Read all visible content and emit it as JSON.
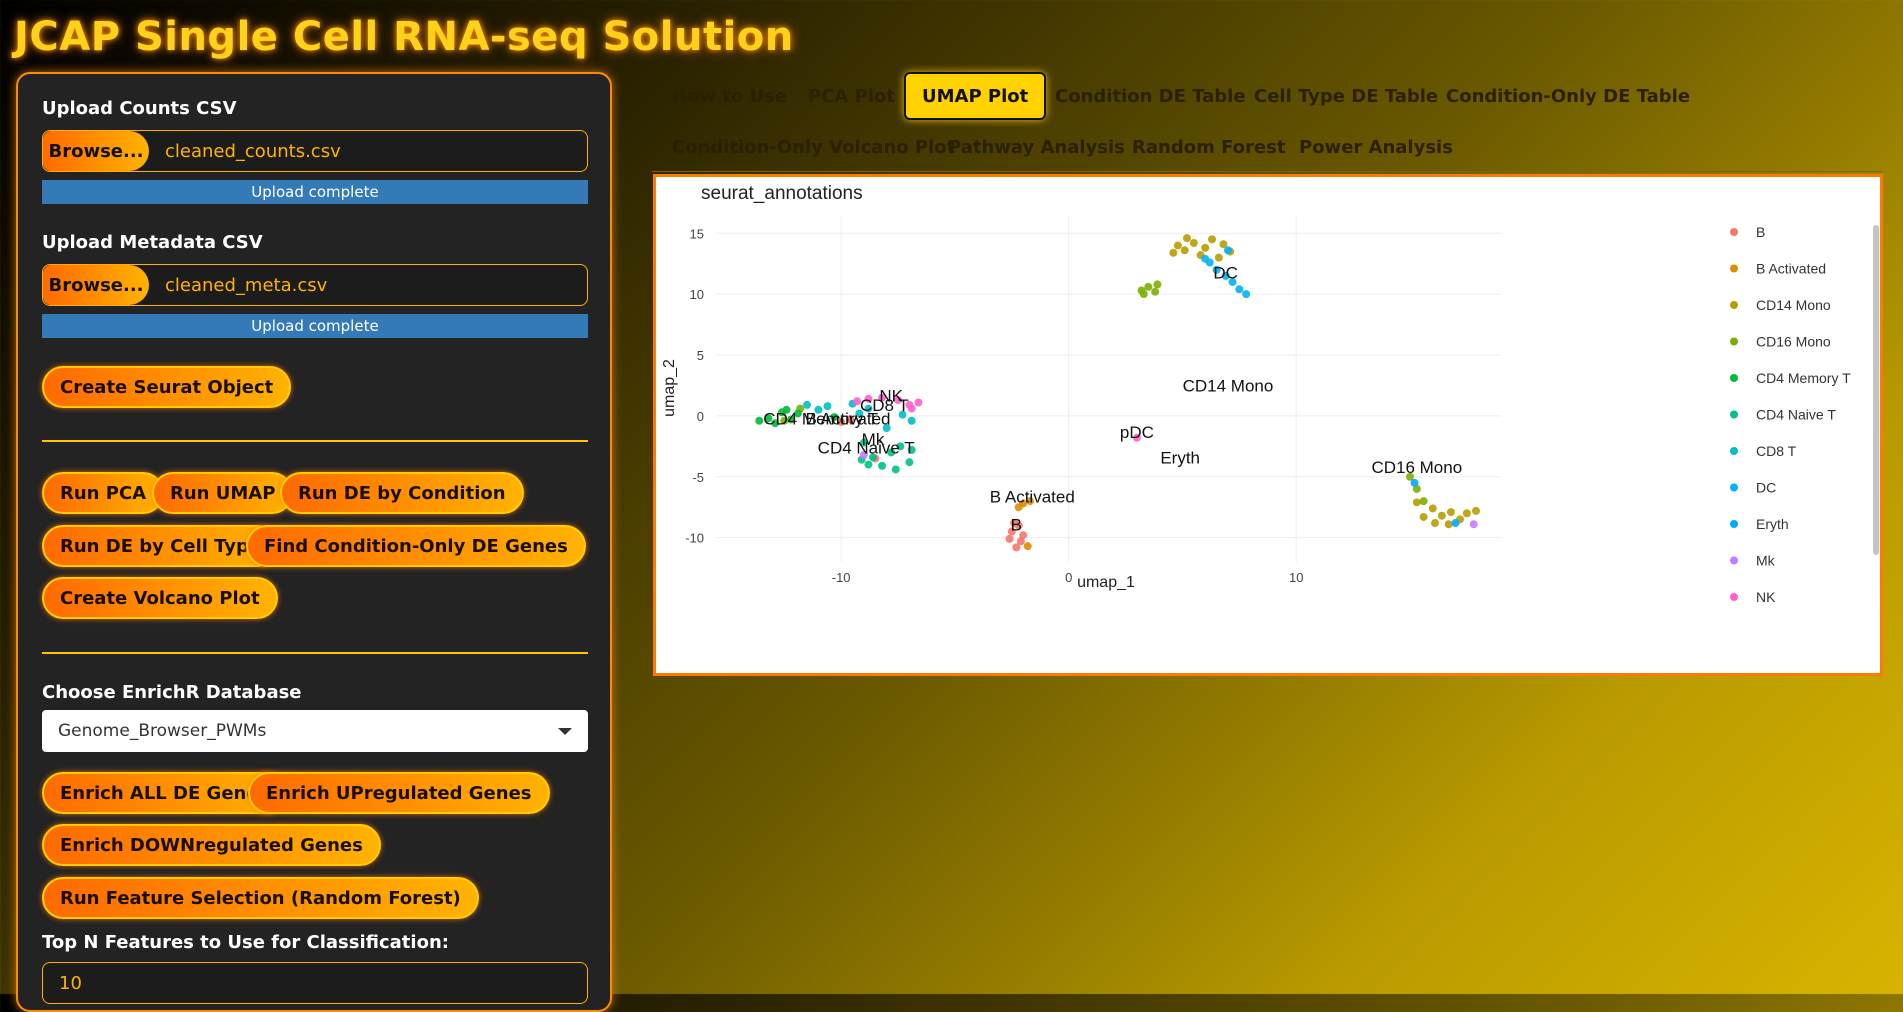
{
  "app": {
    "title": "JCAP Single Cell RNA-seq Solution"
  },
  "sidebar": {
    "counts": {
      "label": "Upload Counts CSV",
      "browse": "Browse...",
      "filename": "cleaned_counts.csv",
      "status": "Upload complete"
    },
    "meta": {
      "label": "Upload Metadata CSV",
      "browse": "Browse...",
      "filename": "cleaned_meta.csv",
      "status": "Upload complete"
    },
    "create_seurat": "Create Seurat Object",
    "run_pca": "Run PCA",
    "run_umap": "Run UMAP",
    "run_de_condition": "Run DE by Condition",
    "run_de_celltype": "Run DE by Cell Type",
    "find_condition_only": "Find Condition-Only DE Genes",
    "create_volcano": "Create Volcano Plot",
    "enrichr_label": "Choose EnrichR Database",
    "enrichr_selected": "Genome_Browser_PWMs",
    "enrich_all": "Enrich ALL DE Genes",
    "enrich_up": "Enrich UPregulated Genes",
    "enrich_down": "Enrich DOWNregulated Genes",
    "run_rf": "Run Feature Selection (Random Forest)",
    "topn_label": "Top N Features to Use for Classification:",
    "topn_value": "10"
  },
  "tabs": [
    {
      "label": "How to Use"
    },
    {
      "label": "PCA Plot"
    },
    {
      "label": "UMAP Plot",
      "active": true
    },
    {
      "label": "Condition DE Table"
    },
    {
      "label": "Cell Type DE Table"
    },
    {
      "label": "Condition-Only DE Table"
    },
    {
      "label": "Condition-Only Volcano Plot"
    },
    {
      "label": "Pathway Analysis"
    },
    {
      "label": "Random Forest"
    },
    {
      "label": "Power Analysis"
    }
  ],
  "chart_data": {
    "type": "scatter",
    "title": "seurat_annotations",
    "xlabel": "umap_1",
    "ylabel": "umap_2",
    "xlim": [
      -15.5,
      19
    ],
    "ylim": [
      -12,
      16.5
    ],
    "xticks": [
      -10,
      0,
      10
    ],
    "yticks": [
      15,
      10,
      5,
      0,
      -5,
      -10
    ],
    "grid": true,
    "legend_position": "right",
    "series": [
      {
        "name": "B",
        "color": "#F8766D",
        "points": [
          [
            -2.2,
            -9
          ],
          [
            -2.5,
            -9.5
          ],
          [
            -2.1,
            -10.3
          ],
          [
            -2.3,
            -10.8
          ],
          [
            -2.6,
            -10.1
          ],
          [
            -2.0,
            -9.8
          ],
          [
            -2.4,
            -8.8
          ],
          [
            -8.5,
            -3.5
          ],
          [
            -10,
            -0.5
          ],
          [
            -9.6,
            -0.3
          ]
        ]
      },
      {
        "name": "B Activated",
        "color": "#DE8C00",
        "points": [
          [
            -2.2,
            -7.5
          ],
          [
            -1.7,
            -7.0
          ],
          [
            -1.8,
            -10.7
          ],
          [
            -2.0,
            -7.2
          ]
        ]
      },
      {
        "name": "CD14 Mono",
        "color": "#B79F00",
        "points": [
          [
            4.8,
            14.0
          ],
          [
            5.1,
            13.6
          ],
          [
            5.5,
            14.2
          ],
          [
            6.0,
            13.8
          ],
          [
            6.3,
            14.5
          ],
          [
            6.8,
            14.1
          ],
          [
            7.1,
            13.5
          ],
          [
            5.8,
            13.2
          ],
          [
            5.2,
            14.6
          ],
          [
            6.6,
            13.0
          ],
          [
            4.6,
            13.4
          ],
          [
            16.0,
            -7.6
          ],
          [
            16.4,
            -8.2
          ],
          [
            16.8,
            -7.9
          ],
          [
            17.2,
            -8.5
          ],
          [
            16.1,
            -8.8
          ],
          [
            17.5,
            -8.0
          ],
          [
            15.6,
            -8.3
          ],
          [
            16.7,
            -8.9
          ],
          [
            17.9,
            -7.8
          ],
          [
            15.3,
            -7.1
          ]
        ]
      },
      {
        "name": "CD16 Mono",
        "color": "#7CAE00",
        "points": [
          [
            3.2,
            10.3
          ],
          [
            3.5,
            10.6
          ],
          [
            3.8,
            10.2
          ],
          [
            3.3,
            10.0
          ],
          [
            3.9,
            10.8
          ],
          [
            -12.5,
            -0.4
          ],
          [
            -11.8,
            0.6
          ],
          [
            15.0,
            -5.0
          ],
          [
            15.3,
            -6.0
          ],
          [
            15.6,
            -7.0
          ]
        ]
      },
      {
        "name": "CD4 Memory T",
        "color": "#00BA38",
        "points": [
          [
            -13.2,
            -0.2
          ],
          [
            -12.9,
            -0.6
          ],
          [
            -12.6,
            0.3
          ],
          [
            -12.2,
            -0.3
          ],
          [
            -11.9,
            0.2
          ],
          [
            -13.6,
            -0.4
          ],
          [
            -12.4,
            0.5
          ],
          [
            -10.3,
            -0.1
          ]
        ]
      },
      {
        "name": "CD4 Naive T",
        "color": "#00C08B",
        "points": [
          [
            -9.0,
            -2.2
          ],
          [
            -8.6,
            -3.4
          ],
          [
            -8.2,
            -4.1
          ],
          [
            -7.8,
            -3.0
          ],
          [
            -7.4,
            -2.5
          ],
          [
            -7.0,
            -3.8
          ],
          [
            -8.8,
            -4.0
          ],
          [
            -7.6,
            -4.4
          ],
          [
            -9.1,
            -3.6
          ],
          [
            -6.9,
            -2.8
          ]
        ]
      },
      {
        "name": "CD8 T",
        "color": "#00BFC4",
        "points": [
          [
            -11.5,
            0.9
          ],
          [
            -11.0,
            0.5
          ],
          [
            -10.6,
            0.8
          ],
          [
            -9.2,
            0.2
          ],
          [
            -8.8,
            0.6
          ],
          [
            -7.3,
            0.1
          ],
          [
            -6.9,
            -0.4
          ],
          [
            -8.0,
            -1.0
          ],
          [
            -9.5,
            1.0
          ]
        ]
      },
      {
        "name": "DC",
        "color": "#00B4F0",
        "points": [
          [
            6.2,
            12.6
          ],
          [
            6.5,
            12.0
          ],
          [
            6.9,
            11.5
          ],
          [
            7.2,
            11.0
          ],
          [
            7.5,
            10.4
          ],
          [
            7.8,
            10.0
          ],
          [
            6.0,
            12.9
          ],
          [
            7.0,
            13.6
          ]
        ]
      },
      {
        "name": "Eryth",
        "color": "#00A9FF",
        "points": [
          [
            17.0,
            -8.8
          ],
          [
            15.2,
            -5.5
          ]
        ]
      },
      {
        "name": "Mk",
        "color": "#C77CFF",
        "points": [
          [
            -9.0,
            -3.2
          ],
          [
            17.8,
            -8.9
          ]
        ]
      },
      {
        "name": "NK",
        "color": "#FF61CC",
        "points": [
          [
            -7.5,
            1.3
          ],
          [
            -7.0,
            0.9
          ],
          [
            -6.6,
            1.1
          ],
          [
            -8.2,
            1.5
          ],
          [
            -8.8,
            1.4
          ],
          [
            -6.9,
            0.6
          ],
          [
            -9.3,
            1.2
          ]
        ]
      },
      {
        "name": "pDC",
        "color": "#FF61CC",
        "points": [
          [
            3.0,
            -1.8
          ]
        ]
      }
    ],
    "annotations": [
      {
        "text": "DC",
        "x": 6.9,
        "y": 11.3
      },
      {
        "text": "CD14 Mono",
        "x": 7.0,
        "y": 2.0
      },
      {
        "text": "pDC",
        "x": 3.0,
        "y": -1.8
      },
      {
        "text": "Eryth",
        "x": 4.9,
        "y": -3.9
      },
      {
        "text": "CD16 Mono",
        "x": 15.3,
        "y": -4.7
      },
      {
        "text": "B Activated",
        "x": -1.6,
        "y": -7.1
      },
      {
        "text": "B",
        "x": -2.3,
        "y": -9.4
      },
      {
        "text": "NK",
        "x": -7.8,
        "y": 1.2
      },
      {
        "text": "CD8 T",
        "x": -8.1,
        "y": 0.4
      },
      {
        "text": "CD4 Memory T",
        "x": -10.9,
        "y": -0.7
      },
      {
        "text": "B Activated",
        "x": -9.7,
        "y": -0.7
      },
      {
        "text": "Mk",
        "x": -8.6,
        "y": -2.4
      },
      {
        "text": "CD4 Naive T",
        "x": -8.9,
        "y": -3.1
      }
    ]
  }
}
